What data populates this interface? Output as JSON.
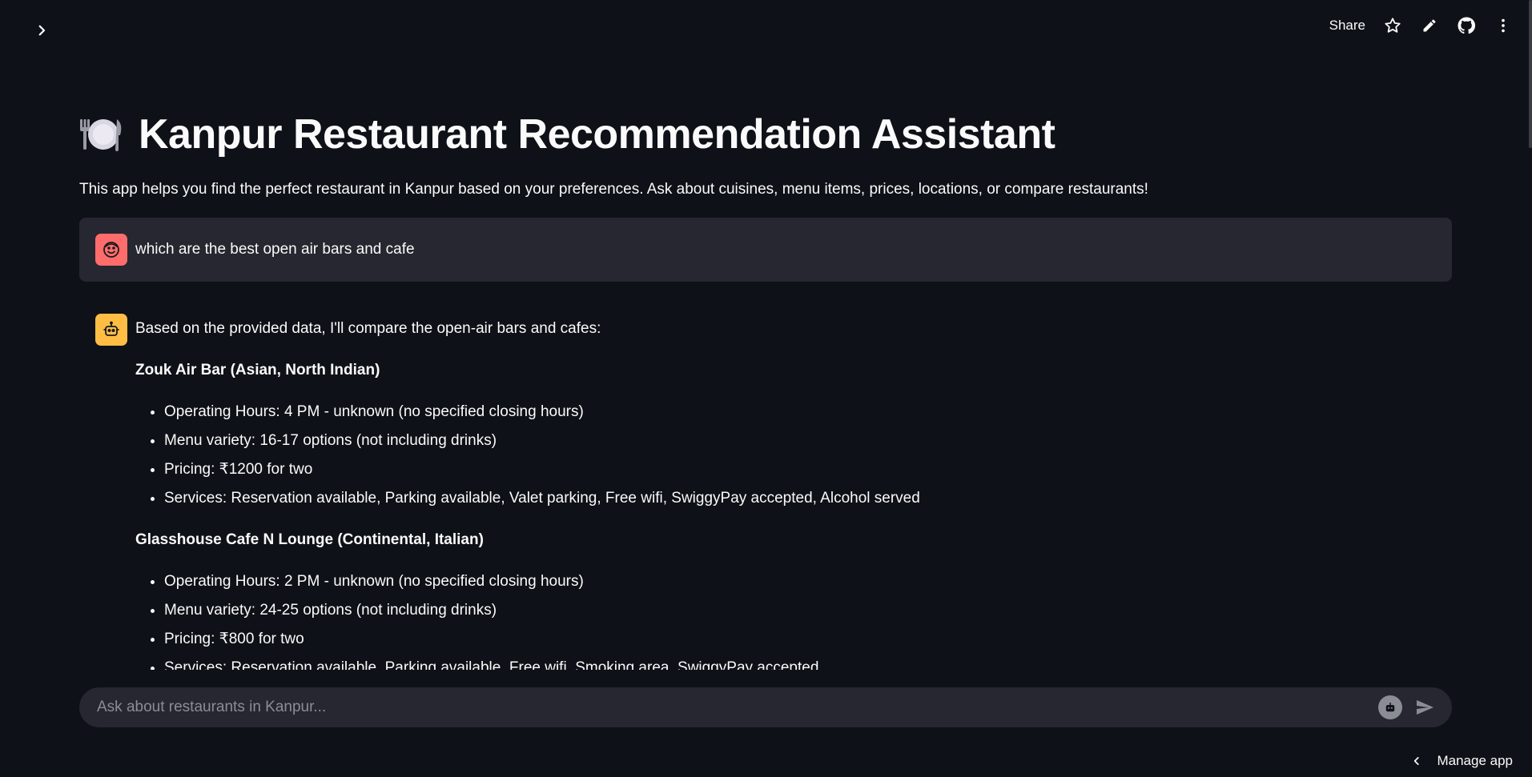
{
  "header": {
    "sidebar_toggle_icon": "chevron-right-icon",
    "share_label": "Share",
    "icons": [
      "star-icon",
      "pencil-icon",
      "github-icon",
      "more-vertical-icon"
    ]
  },
  "page": {
    "title_emoji": "plate-cutlery-icon",
    "title": "Kanpur Restaurant Recommendation Assistant",
    "subtitle": "This app helps you find the perfect restaurant in Kanpur based on your preferences. Ask about cuisines, menu items, prices, locations, or compare restaurants!"
  },
  "chat": {
    "user_message": "which are the best open air bars and cafe",
    "assistant": {
      "intro": "Based on the provided data, I'll compare the open-air bars and cafes:",
      "sections": [
        {
          "title": "Zouk Air Bar (Asian, North Indian)",
          "items": [
            "Operating Hours: 4 PM - unknown (no specified closing hours)",
            "Menu variety: 16-17 options (not including drinks)",
            "Pricing: ₹1200 for two",
            "Services: Reservation available, Parking available, Valet parking, Free wifi, SwiggyPay accepted, Alcohol served"
          ]
        },
        {
          "title": "Glasshouse Cafe N Lounge (Continental, Italian)",
          "items": [
            "Operating Hours: 2 PM - unknown (no specified closing hours)",
            "Menu variety: 24-25 options (not including drinks)",
            "Pricing: ₹800 for two",
            "Services: Reservation available, Parking available, Free wifi, Smoking area, SwiggyPay accepted"
          ]
        }
      ]
    }
  },
  "input": {
    "placeholder": "Ask about restaurants in Kanpur..."
  },
  "footer": {
    "manage_app_label": "Manage app"
  },
  "colors": {
    "background": "#0e1117",
    "surface": "#262730",
    "user_avatar": "#ff6c6c",
    "bot_avatar": "#ffbd45"
  }
}
